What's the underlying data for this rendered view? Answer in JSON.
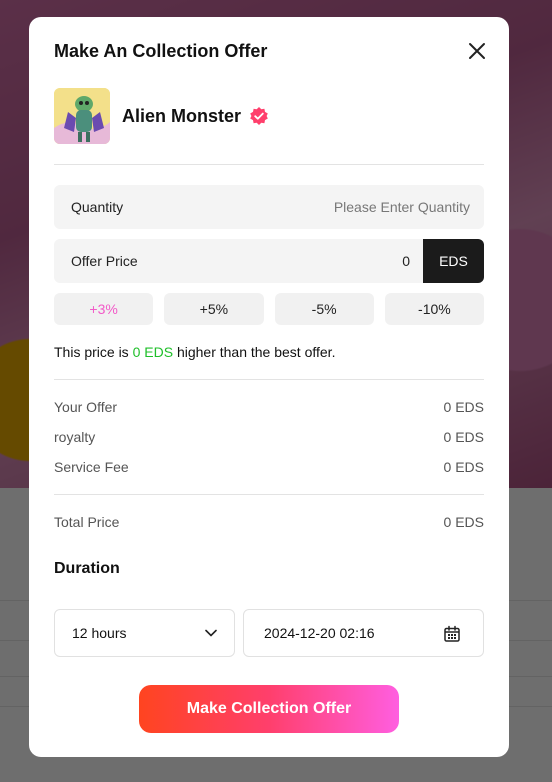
{
  "modal": {
    "title": "Make An Collection Offer"
  },
  "collection": {
    "name": "Alien Monster"
  },
  "quantity": {
    "label": "Quantity",
    "placeholder": "Please Enter Quantity",
    "value": ""
  },
  "offer_price": {
    "label": "Offer Price",
    "value": "0",
    "currency": "EDS"
  },
  "adjustments": [
    {
      "label": "+3%",
      "active": true
    },
    {
      "label": "+5%",
      "active": false
    },
    {
      "label": "-5%",
      "active": false
    },
    {
      "label": "-10%",
      "active": false
    }
  ],
  "price_note": {
    "prefix": "This price is",
    "amount": "0 EDS",
    "suffix": "higher than the best offer."
  },
  "summary": {
    "your_offer": {
      "label": "Your Offer",
      "value": "0 EDS"
    },
    "royalty": {
      "label": "royalty",
      "value": "0 EDS"
    },
    "service_fee": {
      "label": "Service Fee",
      "value": "0 EDS"
    },
    "total_price": {
      "label": "Total Price",
      "value": "0 EDS"
    }
  },
  "duration": {
    "title": "Duration",
    "selected": "12 hours",
    "end_datetime": "2024-12-20 02:16"
  },
  "submit_label": "Make Collection Offer",
  "colors": {
    "accent_pink": "#f25ac8",
    "positive_green": "#1fbf2a",
    "button_gradient_start": "#ff4420",
    "button_gradient_end": "#ff5ee0",
    "verified_badge": "#ff3f6c"
  },
  "icons": {
    "close": "close-icon",
    "verified": "verified-badge-icon",
    "chevron": "chevron-down-icon",
    "calendar": "calendar-icon"
  }
}
